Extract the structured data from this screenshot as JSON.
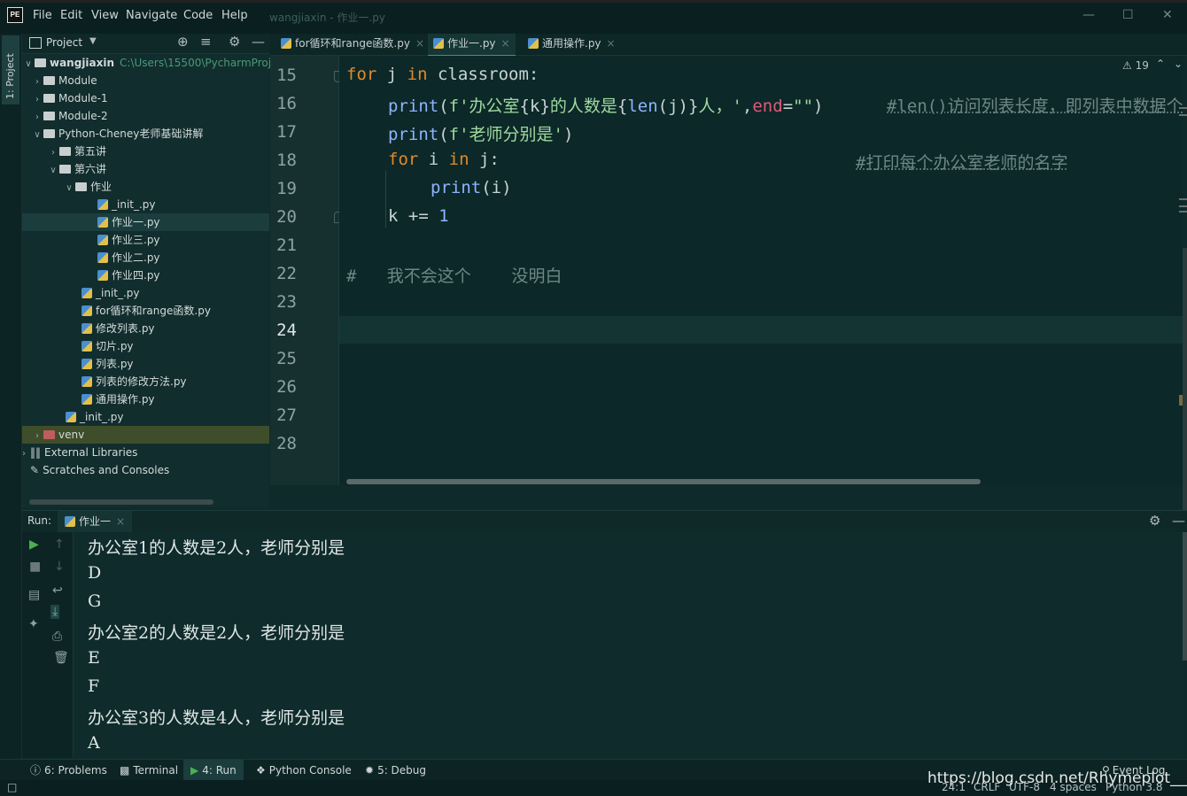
{
  "menu": {
    "file": "File",
    "edit": "Edit",
    "view": "View",
    "navigate": "Navigate",
    "code": "Code",
    "help": "Help"
  },
  "window_title": "wangjiaxin - 作业一.py",
  "left_stripe_label": "1: Project",
  "project_panel": {
    "title": "Project",
    "root": {
      "name": "wangjiaxin",
      "path": "C:\\Users\\15500\\PycharmProje"
    },
    "items": [
      {
        "label": "Module"
      },
      {
        "label": "Module-1"
      },
      {
        "label": "Module-2"
      },
      {
        "label": "Python-Cheney老师基础讲解"
      },
      {
        "label": "第五讲"
      },
      {
        "label": "第六讲"
      },
      {
        "label": "作业"
      },
      {
        "label": "_init_.py"
      },
      {
        "label": "作业一.py"
      },
      {
        "label": "作业三.py"
      },
      {
        "label": "作业二.py"
      },
      {
        "label": "作业四.py"
      },
      {
        "label": "_init_.py"
      },
      {
        "label": "for循环和range函数.py"
      },
      {
        "label": "修改列表.py"
      },
      {
        "label": "切片.py"
      },
      {
        "label": "列表.py"
      },
      {
        "label": "列表的修改方法.py"
      },
      {
        "label": "通用操作.py"
      },
      {
        "label": "_init_.py"
      },
      {
        "label": "venv"
      },
      {
        "label": "External Libraries"
      },
      {
        "label": "Scratches and Consoles"
      }
    ]
  },
  "editor_tabs": [
    {
      "label": "for循环和range函数.py"
    },
    {
      "label": "作业一.py"
    },
    {
      "label": "通用操作.py"
    }
  ],
  "editor": {
    "warning_count": "19",
    "line_numbers": [
      "15",
      "16",
      "17",
      "18",
      "19",
      "20",
      "21",
      "22",
      "23",
      "24",
      "25",
      "26",
      "27",
      "28"
    ],
    "code": {
      "l15_a": "for",
      "l15_b": " j ",
      "l15_c": "in",
      "l15_d": " classroom:",
      "l16_a": "print",
      "l16_b": "(",
      "l16_c": "f'办公室",
      "l16_d": "{k}",
      "l16_e": "的人数是",
      "l16_f": "{",
      "l16_g": "len",
      "l16_h": "(j)",
      "l16_i": "}",
      "l16_j": "人，'",
      "l16_k": ",",
      "l16_l": "end",
      "l16_m": "=",
      "l16_n": "\"\"",
      "l16_o": ")",
      "l16_comment": "#len()访问列表长度，即列表中数据个数",
      "l17_a": "print",
      "l17_b": "(",
      "l17_c": "f'老师分别是'",
      "l17_d": ")",
      "l18_a": "for",
      "l18_b": " i ",
      "l18_c": "in",
      "l18_d": " j:",
      "l18_comment": "#打印每个办公室老师的名字",
      "l19_a": "print",
      "l19_b": "(i)",
      "l20_a": "k += ",
      "l20_b": "1",
      "l22": "#   我不会这个    没明白"
    }
  },
  "run_panel": {
    "label": "Run:",
    "tab": "作业一",
    "output": [
      "办公室1的人数是2人，老师分别是",
      "D",
      "G",
      "办公室2的人数是2人，老师分别是",
      "E",
      "F",
      "办公室3的人数是4人，老师分别是",
      "A"
    ]
  },
  "bottom_tabs": [
    {
      "label": "6: Problems"
    },
    {
      "label": "Terminal"
    },
    {
      "label": "4: Run"
    },
    {
      "label": "Python Console"
    },
    {
      "label": "5: Debug"
    }
  ],
  "event_log": "Event Log",
  "status": {
    "position": "24:1",
    "line_sep": "CRLF",
    "encoding": "UTF-8",
    "indent": "4 spaces",
    "interpreter": "Python 3.8"
  },
  "watermark": "https://blog.csdn.net/Rhymeplot___JDQS",
  "colors": {
    "keyword": "#e08a2c",
    "function": "#8fb4ff",
    "string": "#9fd89f",
    "param": "#e05a7a",
    "comment": "#6f8686",
    "background": "#0c2828"
  }
}
